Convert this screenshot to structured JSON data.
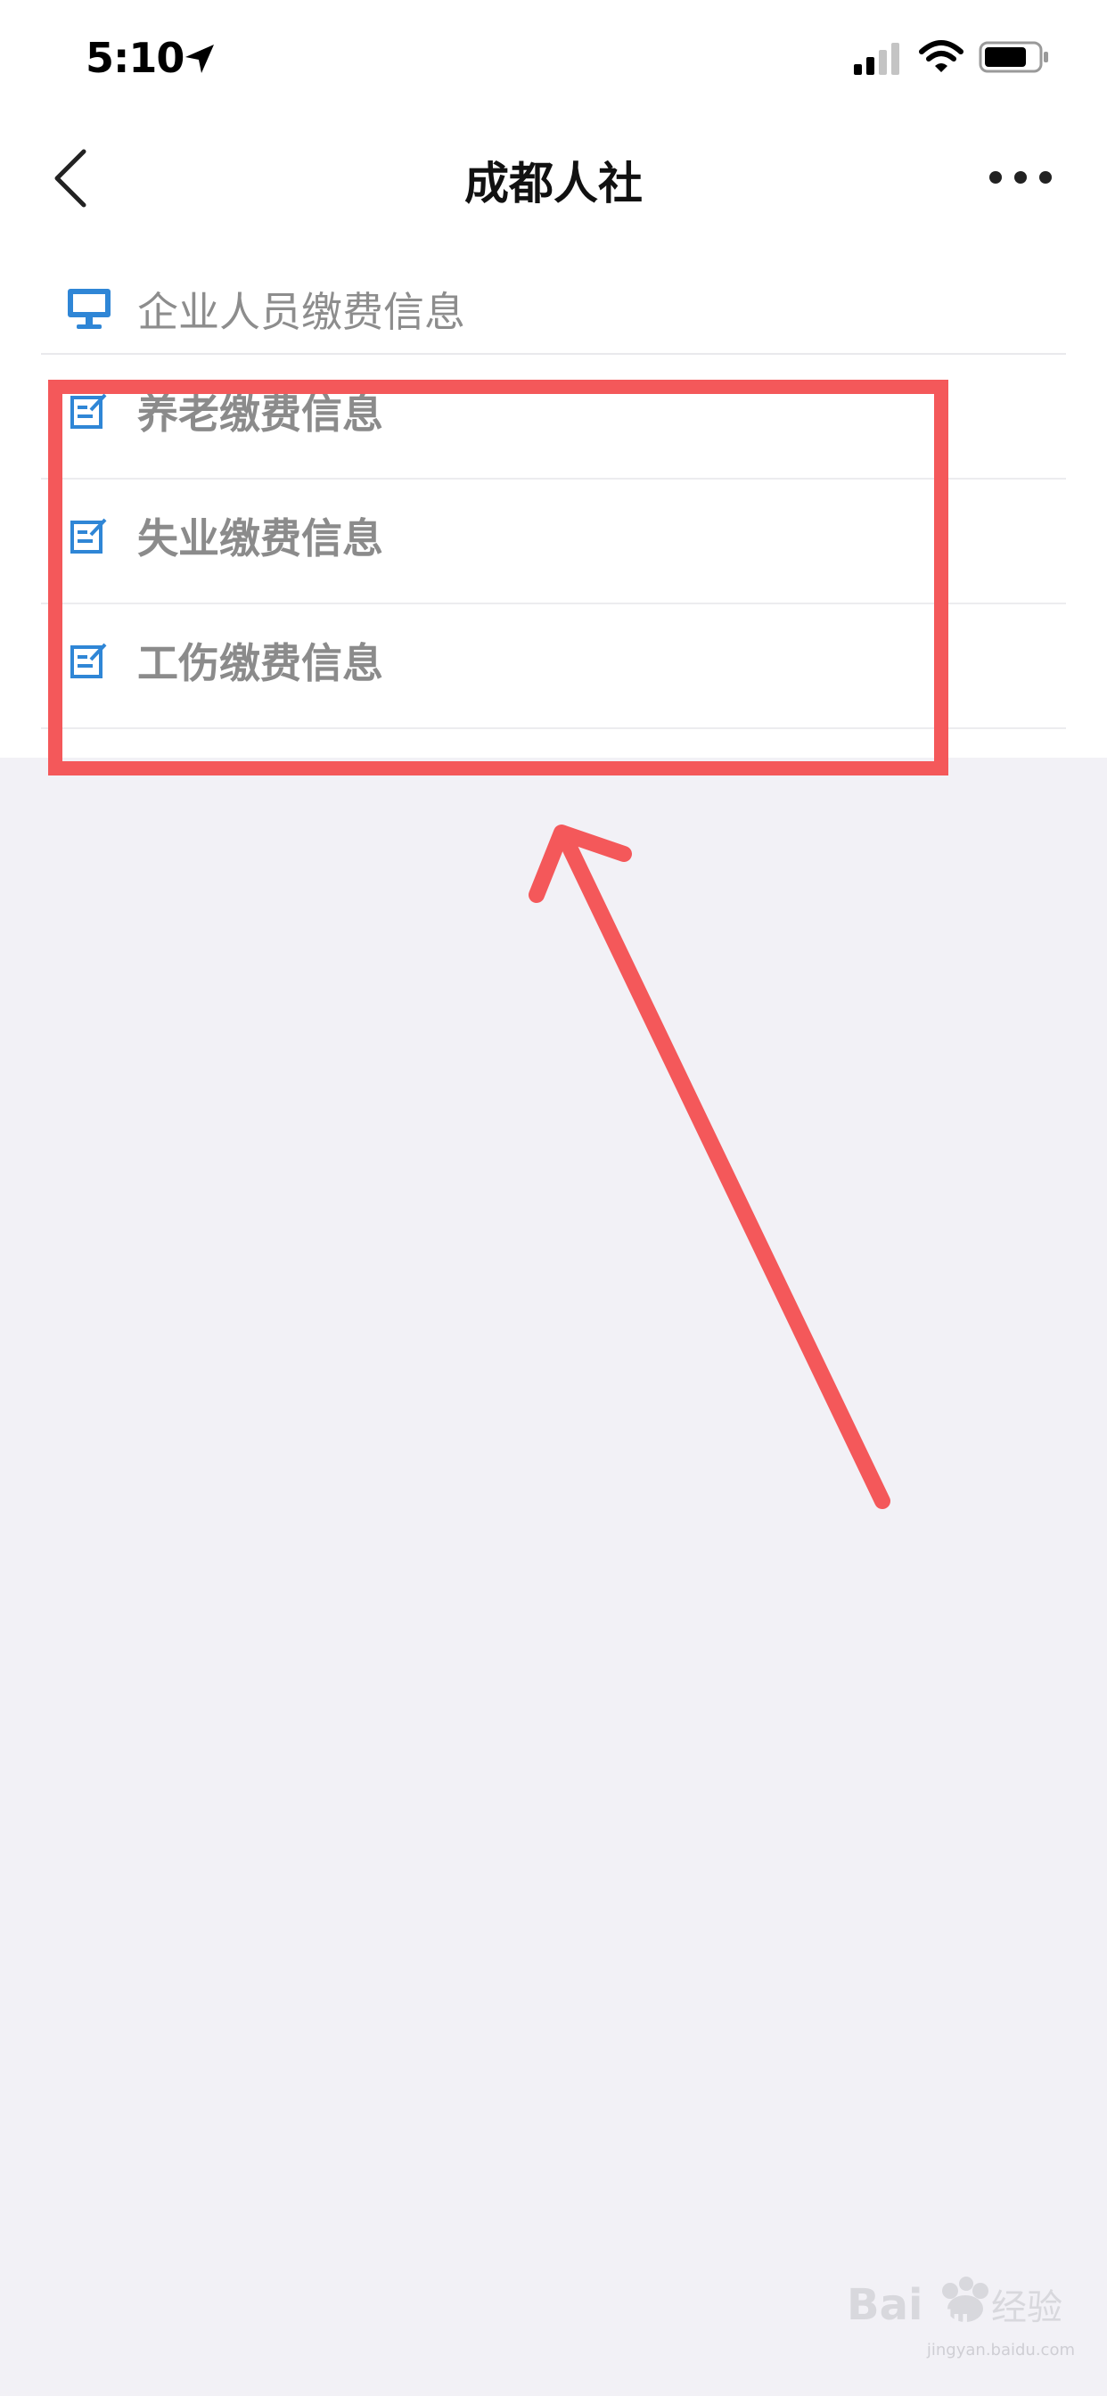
{
  "status_bar": {
    "time": "5:10"
  },
  "nav": {
    "title": "成都人社"
  },
  "section": {
    "label": "企业人员缴费信息",
    "icon": "monitor-icon"
  },
  "items": [
    {
      "label": "养老缴费信息",
      "icon": "edit-note-icon"
    },
    {
      "label": "失业缴费信息",
      "icon": "edit-note-icon"
    },
    {
      "label": "工伤缴费信息",
      "icon": "edit-note-icon"
    }
  ],
  "watermark": {
    "brand": "Baidu经验",
    "url": "jingyan.baidu.com"
  },
  "colors": {
    "accent_blue": "#2f86d6",
    "annotation_red": "#f4585a",
    "background": "#f2f1f6"
  }
}
